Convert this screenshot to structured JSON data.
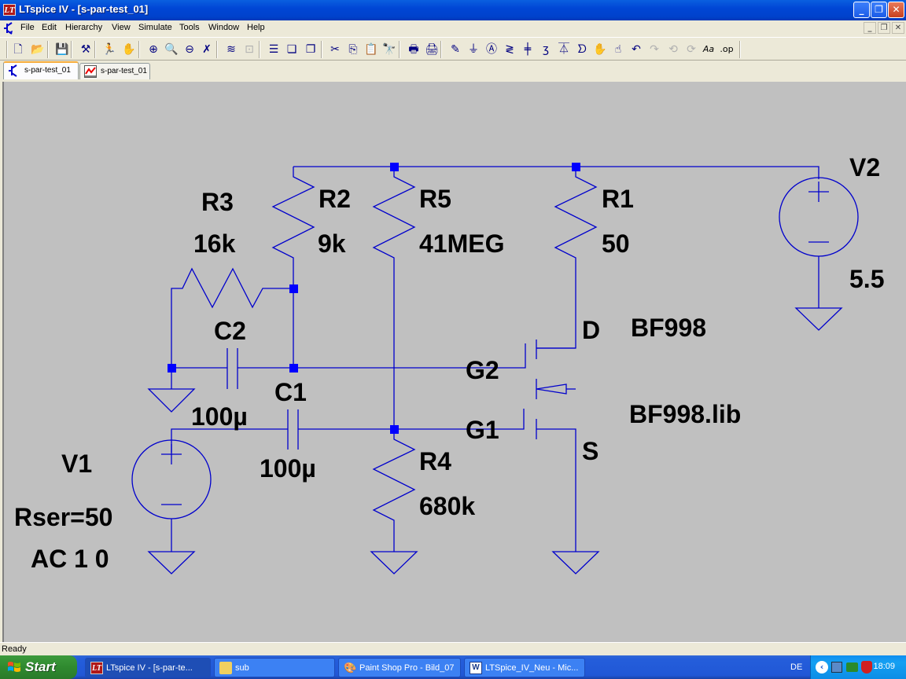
{
  "window": {
    "title": "LTspice IV - [s-par-test_01]",
    "app_icon_text": "LT",
    "minimize": "_",
    "restore": "❐",
    "close": "✕"
  },
  "menu": {
    "items": [
      "File",
      "Edit",
      "Hierarchy",
      "View",
      "Simulate",
      "Tools",
      "Window",
      "Help"
    ],
    "mdi_minimize": "_",
    "mdi_restore": "❐",
    "mdi_close": "✕"
  },
  "toolbar": {
    "buttons": [
      {
        "name": "new-schematic",
        "glyph": "🗋"
      },
      {
        "name": "open",
        "glyph": "📂"
      },
      {
        "name": "save",
        "glyph": "💾"
      },
      {
        "name": "control-panel",
        "glyph": "⚒"
      },
      {
        "name": "run",
        "glyph": "🏃"
      },
      {
        "name": "halt",
        "glyph": "✋"
      },
      {
        "name": "zoom-in",
        "glyph": "⊕"
      },
      {
        "name": "pan",
        "glyph": "🔍"
      },
      {
        "name": "zoom-out",
        "glyph": "⊖"
      },
      {
        "name": "zoom-fit",
        "glyph": "✗"
      },
      {
        "name": "autorange",
        "glyph": "≋"
      },
      {
        "name": "plot-settings",
        "glyph": "⊡"
      },
      {
        "name": "tile-horizontal",
        "glyph": "☰"
      },
      {
        "name": "cascade",
        "glyph": "❏"
      },
      {
        "name": "tile-vertical",
        "glyph": "❐"
      },
      {
        "name": "cut",
        "glyph": "✂"
      },
      {
        "name": "copy",
        "glyph": "⎘"
      },
      {
        "name": "paste",
        "glyph": "📋"
      },
      {
        "name": "find",
        "glyph": "🔭"
      },
      {
        "name": "print-preview",
        "glyph": "🖶"
      },
      {
        "name": "print",
        "glyph": "🖨"
      },
      {
        "name": "draw-wire",
        "glyph": "✎"
      },
      {
        "name": "place-ground",
        "glyph": "⏚"
      },
      {
        "name": "label-net",
        "glyph": "Ⓐ"
      },
      {
        "name": "place-resistor",
        "glyph": "≷"
      },
      {
        "name": "place-capacitor",
        "glyph": "╪"
      },
      {
        "name": "place-inductor",
        "glyph": "ʒ"
      },
      {
        "name": "place-diode",
        "glyph": "⏄"
      },
      {
        "name": "place-component",
        "glyph": "ᗤ"
      },
      {
        "name": "move",
        "glyph": "✋"
      },
      {
        "name": "drag",
        "glyph": "☝"
      },
      {
        "name": "undo",
        "glyph": "↶"
      },
      {
        "name": "redo",
        "glyph": "↷"
      },
      {
        "name": "rotate",
        "glyph": "⟲"
      },
      {
        "name": "mirror",
        "glyph": "⟳"
      },
      {
        "name": "text",
        "glyph": "Aa"
      },
      {
        "name": "spice-directive",
        "glyph": ".op"
      }
    ]
  },
  "tabs": [
    {
      "label": "s-par-test_01",
      "type": "schematic",
      "active": true
    },
    {
      "label": "s-par-test_01",
      "type": "waveform",
      "active": false
    }
  ],
  "schematic": {
    "wire_color": "#0000cc",
    "junction_color": "#0000ff",
    "background": "#c0c0c0",
    "components": {
      "R1": {
        "name": "R1",
        "value": "50"
      },
      "R2": {
        "name": "R2",
        "value": "9k"
      },
      "R3": {
        "name": "R3",
        "value": "16k"
      },
      "R4": {
        "name": "R4",
        "value": "680k"
      },
      "R5": {
        "name": "R5",
        "value": "41MEG"
      },
      "C1": {
        "name": "C1",
        "value": "100µ"
      },
      "C2": {
        "name": "C2",
        "value": "100µ"
      },
      "V1": {
        "name": "V1",
        "value": "Rser=50",
        "value2": "AC 1 0"
      },
      "V2": {
        "name": "V2",
        "value": "5.5"
      },
      "M1": {
        "name": "BF998",
        "value": "BF998.lib",
        "pin_d": "D",
        "pin_g2": "G2",
        "pin_g1": "G1",
        "pin_s": "S"
      }
    }
  },
  "status": {
    "text": "Ready"
  },
  "taskbar": {
    "start": "Start",
    "tasks": [
      {
        "label": "LTspice IV - [s-par-te...",
        "active": true
      },
      {
        "label": "sub",
        "active": false
      },
      {
        "label": "Paint Shop Pro - Bild_07",
        "active": false
      },
      {
        "label": "LTSpice_IV_Neu - Mic...",
        "active": false
      }
    ],
    "language": "DE",
    "clock": "18:09"
  }
}
